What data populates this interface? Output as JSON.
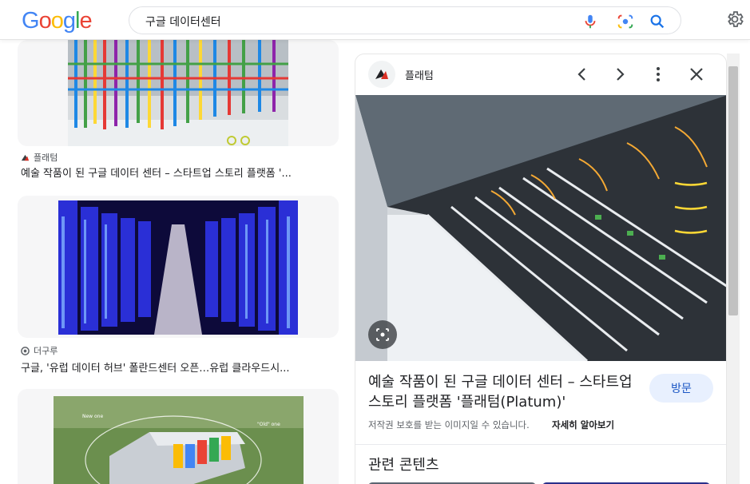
{
  "header": {
    "logo_letters": [
      "G",
      "o",
      "o",
      "g",
      "l",
      "e"
    ],
    "logo_colors": [
      "#4285F4",
      "#EA4335",
      "#FBBC05",
      "#4285F4",
      "#34A853",
      "#EA4335"
    ],
    "search_value": "구글 데이터센터",
    "icons": [
      "mic-icon",
      "google-lens-icon",
      "search-icon",
      "settings-gear-icon"
    ]
  },
  "results": [
    {
      "source": "플래텀",
      "title": "예술 작품이 된 구글 데이터 센터 – 스타트업 스토리 플랫폼 '..."
    },
    {
      "source": "더구루",
      "title": "구글, '유럽 데이터 허브' 폴란드센터 오픈…유럽 클라우드시..."
    },
    {
      "source": "",
      "title": ""
    }
  ],
  "result3_labels": {
    "new_one": "New one",
    "old_one": "\"Old\" one"
  },
  "preview": {
    "site_name": "플래텀",
    "title": "예술 작품이 된 구글 데이터 센터 – 스타트업 스토리 플랫폼 '플래텀(Platum)'",
    "visit_label": "방문",
    "copyright_text": "저작권 보호를 받는 이미지일 수 있습니다.",
    "learn_more": "자세히 알아보기",
    "related_heading": "관련 콘텐츠"
  },
  "colors": {
    "accent_blue": "#1a73e8",
    "visit_bg": "#e8f0fe"
  }
}
